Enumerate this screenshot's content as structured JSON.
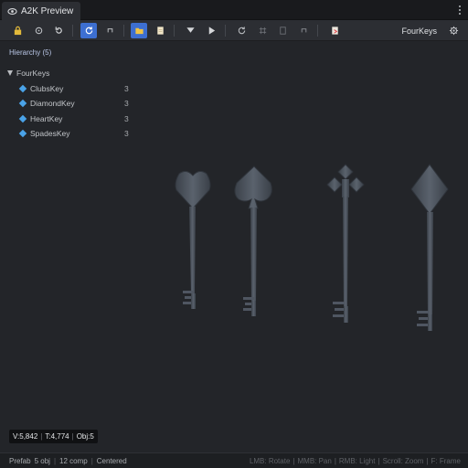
{
  "tab": {
    "title": "A2K Preview"
  },
  "toolbar": {
    "scene_name": "FourKeys"
  },
  "hierarchy": {
    "title": "Hierarchy (5)",
    "root": "FourKeys",
    "items": [
      {
        "label": "ClubsKey",
        "count": "3"
      },
      {
        "label": "DiamondKey",
        "count": "3"
      },
      {
        "label": "HeartKey",
        "count": "3"
      },
      {
        "label": "SpadesKey",
        "count": "3"
      }
    ]
  },
  "stats": {
    "verts": "V:5,842",
    "tris": "T:4,774",
    "objs": "Obj:5"
  },
  "status": {
    "left": [
      "Prefab",
      "5 obj",
      "12 comp",
      "Centered"
    ],
    "right": [
      "LMB: Rotate",
      "MMB: Pan",
      "RMB: Light",
      "Scroll: Zoom",
      "F: Frame"
    ]
  },
  "colors": {
    "accent": "#3d6fd1",
    "node_icon": "#4aa3e8",
    "key_metal": "#4f5661"
  },
  "icons": [
    "eye-icon",
    "lock-icon",
    "pivot-icon",
    "reset-icon",
    "orbit-icon",
    "bracket-icon",
    "folder-icon",
    "file-icon",
    "filter-icon",
    "play-icon",
    "refresh-icon",
    "grid-icon",
    "frame-icon",
    "box-icon",
    "export-icon",
    "settings-icon"
  ]
}
